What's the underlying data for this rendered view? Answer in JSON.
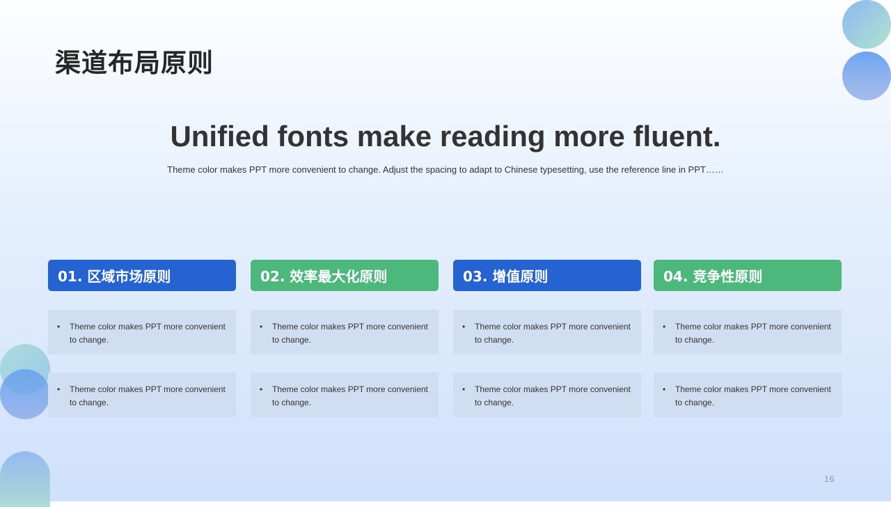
{
  "slide": {
    "title": "渠道布局原则",
    "headline": "Unified fonts make reading more fluent.",
    "subline": "Theme color makes PPT more convenient to change. Adjust the spacing to adapt to Chinese typesetting, use the reference line in PPT……",
    "page_number": "16"
  },
  "colors": {
    "blue": "#2563d3",
    "green": "#4cb87c",
    "card": "#cfdef0"
  },
  "columns": [
    {
      "heading": "01. 区域市场原则",
      "color": "#2563d3",
      "items": [
        "Theme color makes PPT more convenient to change.",
        "Theme color makes PPT more convenient to change."
      ]
    },
    {
      "heading": "02. 效率最大化原则",
      "color": "#4cb87c",
      "items": [
        "Theme color makes PPT more convenient to change.",
        "Theme color makes PPT more convenient to change."
      ]
    },
    {
      "heading": "03. 增值原则",
      "color": "#2563d3",
      "items": [
        "Theme color makes PPT more convenient to change.",
        "Theme color makes PPT more convenient to change."
      ]
    },
    {
      "heading": "04. 竞争性原则",
      "color": "#4cb87c",
      "items": [
        "Theme color makes PPT more convenient to change.",
        "Theme color makes PPT more convenient to change."
      ]
    }
  ],
  "bullet_glyph": "•"
}
